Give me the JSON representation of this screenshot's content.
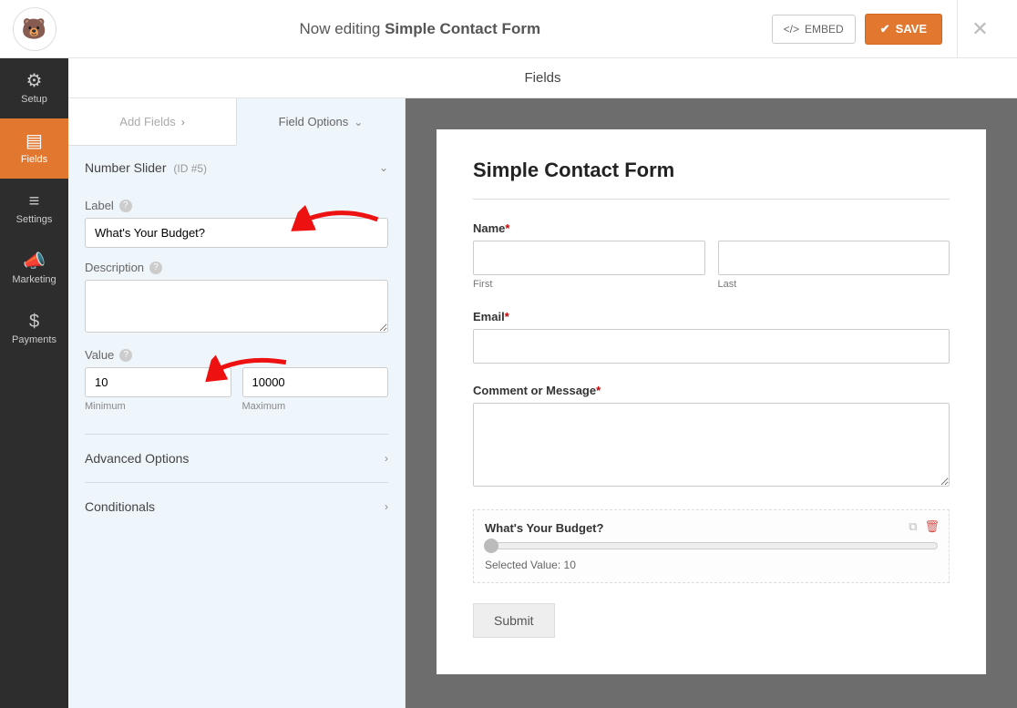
{
  "topbar": {
    "editing_prefix": "Now editing ",
    "form_name": "Simple Contact Form",
    "embed_label": "EMBED",
    "save_label": "SAVE"
  },
  "rail": {
    "setup": "Setup",
    "fields": "Fields",
    "settings": "Settings",
    "marketing": "Marketing",
    "payments": "Payments"
  },
  "section_title": "Fields",
  "panel_tabs": {
    "add": "Add Fields",
    "options": "Field Options"
  },
  "options": {
    "type_name": "Number Slider",
    "id_text": "(ID #5)",
    "label_label": "Label",
    "label_value": "What's Your Budget?",
    "desc_label": "Description",
    "desc_value": "",
    "value_label": "Value",
    "min_value": "10",
    "min_label": "Minimum",
    "max_value": "10000",
    "max_label": "Maximum",
    "advanced": "Advanced Options",
    "conditionals": "Conditionals"
  },
  "preview": {
    "title": "Simple Contact Form",
    "name_label": "Name",
    "first": "First",
    "last": "Last",
    "email_label": "Email",
    "comment_label": "Comment or Message",
    "budget_label": "What's Your Budget?",
    "selected_prefix": "Selected Value: ",
    "selected_value": "10",
    "submit": "Submit"
  }
}
